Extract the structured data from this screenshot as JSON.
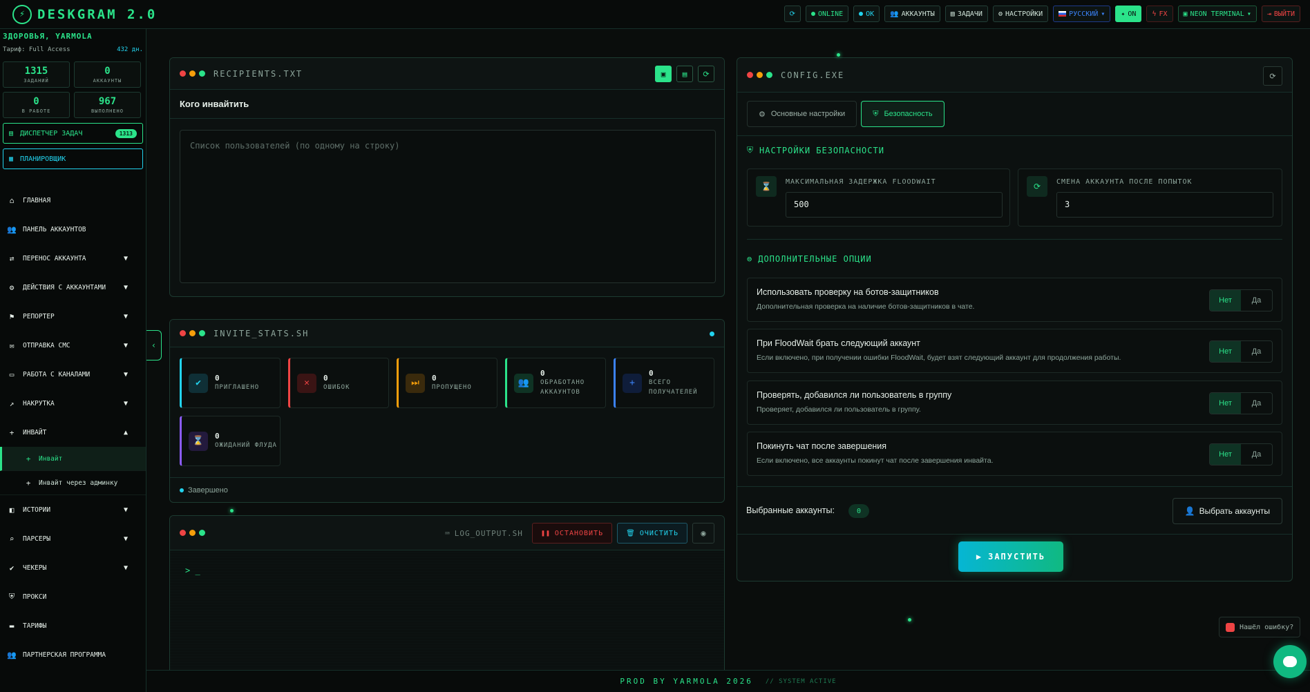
{
  "app": {
    "logo_mark": "⚡",
    "title": "DESKGRAM 2.0"
  },
  "topbar": {
    "refresh_icon": "refresh-icon",
    "online": "ONLINE",
    "ok": "OK",
    "accounts": "АККАУНТЫ",
    "tasks": "ЗАДАЧИ",
    "settings": "НАСТРОЙКИ",
    "language": "РУССКИЙ",
    "on": "ON",
    "fx": "FX",
    "theme": "NEON TERMINAL",
    "logout": "ВЫЙТИ"
  },
  "sidebar": {
    "greeting": "ЗДОРОВЬЯ, YARMOLA",
    "tariff_label": "Тариф: Full Access",
    "tariff_days": "432 дн.",
    "stats": [
      {
        "value": "1315",
        "label": "ЗАДАНИЙ"
      },
      {
        "value": "0",
        "label": "АККАУНТЫ"
      },
      {
        "value": "0",
        "label": "В РАБОТЕ"
      },
      {
        "value": "967",
        "label": "ВЫПОЛНЕНО"
      }
    ],
    "dispatcher": {
      "label": "ДИСПЕТЧЕР ЗАДАЧ",
      "badge": "1313"
    },
    "planner": "ПЛАНИРОВЩИК",
    "nav": [
      {
        "label": "ГЛАВНАЯ",
        "icon": "home-icon",
        "chev": ""
      },
      {
        "label": "ПАНЕЛЬ АККАУНТОВ",
        "icon": "users-icon",
        "chev": ""
      },
      {
        "label": "ПЕРЕНОС АККАУНТА",
        "icon": "user-transfer-icon",
        "chev": "▼"
      },
      {
        "label": "ДЕЙСТВИЯ С АККАУНТАМИ",
        "icon": "user-gear-icon",
        "chev": "▼"
      },
      {
        "label": "РЕПОРТЕР",
        "icon": "flag-icon",
        "chev": "▼"
      },
      {
        "label": "ОТПРАВКА СМС",
        "icon": "chat-icon",
        "chev": "▼"
      },
      {
        "label": "РАБОТА С КАНАЛАМИ",
        "icon": "briefcase-icon",
        "chev": "▼"
      },
      {
        "label": "НАКРУТКА",
        "icon": "chart-icon",
        "chev": "▼"
      },
      {
        "label": "ИНВАЙТ",
        "icon": "user-plus-icon",
        "chev": "▲"
      }
    ],
    "sub": [
      {
        "label": "Инвайт"
      },
      {
        "label": "Инвайт через админку"
      }
    ],
    "nav2": [
      {
        "label": "ИСТОРИИ",
        "icon": "stories-icon",
        "chev": "▼"
      },
      {
        "label": "ПАРСЕРЫ",
        "icon": "search-icon",
        "chev": "▼"
      },
      {
        "label": "ЧЕКЕРЫ",
        "icon": "check-icon",
        "chev": "▼"
      },
      {
        "label": "ПРОКСИ",
        "icon": "shield-icon",
        "chev": ""
      },
      {
        "label": "ТАРИФЫ",
        "icon": "card-icon",
        "chev": ""
      },
      {
        "label": "ПАРТНЕРСКАЯ ПРОГРАММА",
        "icon": "partners-icon",
        "chev": ""
      }
    ]
  },
  "recipients": {
    "title": "RECIPIENTS.TXT",
    "section": "Кого инвайтить",
    "placeholder": "Список пользователей (по одному на строку)"
  },
  "stats": {
    "title": "INVITE_STATS.SH",
    "tiles": [
      {
        "value": "0",
        "label": "ПРИГЛАШЕНО",
        "icon": "check-circle-icon",
        "color": "#22d3ee"
      },
      {
        "value": "0",
        "label": "ОШИБОК",
        "icon": "x-circle-icon",
        "color": "#ef4444"
      },
      {
        "value": "0",
        "label": "ПРОПУЩЕНО",
        "icon": "skip-icon",
        "color": "#f59e0b"
      },
      {
        "value": "0",
        "label": "ОБРАБОТАНО АККАУНТОВ",
        "icon": "users-icon",
        "color": "#2be38a"
      },
      {
        "value": "0",
        "label": "ВСЕГО ПОЛУЧАТЕЛЕЙ",
        "icon": "user-plus-icon",
        "color": "#3b82f6"
      },
      {
        "value": "0",
        "label": "ОЖИДАНИЙ ФЛУДА",
        "icon": "hourglass-icon",
        "color": "#8b5cf6"
      }
    ],
    "status": "Завершено"
  },
  "log": {
    "filename": "LOG_OUTPUT.SH",
    "stop": "ОСТАНОВИТЬ",
    "clear": "ОЧИСТИТЬ",
    "prompt": "> _"
  },
  "config": {
    "title": "CONFIG.EXE",
    "tab_main": "Основные настройки",
    "tab_security": "Безопасность",
    "security_heading": "НАСТРОЙКИ БЕЗОПАСНОСТИ",
    "floodwait_label": "МАКСИМАЛЬНАЯ ЗАДЕРЖКА FLOODWAIT",
    "floodwait_value": "500",
    "switch_label": "СМЕНА АККАУНТА ПОСЛЕ ПОПЫТОК",
    "switch_value": "3",
    "extra_heading": "ДОПОЛНИТЕЛЬНЫЕ ОПЦИИ",
    "options": [
      {
        "title": "Использовать проверку на ботов-защитников",
        "desc": "Дополнительная проверка на наличие ботов-защитников в чате.",
        "no": "Нет",
        "yes": "Да"
      },
      {
        "title": "При FloodWait брать следующий аккаунт",
        "desc": "Если включено, при получении ошибки FloodWait, будет взят следующий аккаунт для продолжения работы.",
        "no": "Нет",
        "yes": "Да"
      },
      {
        "title": "Проверять, добавился ли пользователь в группу",
        "desc": "Проверяет, добавился ли пользователь в группу.",
        "no": "Нет",
        "yes": "Да"
      },
      {
        "title": "Покинуть чат после завершения",
        "desc": "Если включено, все аккаунты покинут чат после завершения инвайта.",
        "no": "Нет",
        "yes": "Да"
      }
    ],
    "selected_label": "Выбранные аккаунты:",
    "selected_count": "0",
    "choose_btn": "Выбрать аккаунты",
    "run_btn": "ЗАПУСТИТЬ"
  },
  "footer": {
    "prod": "PROD BY YARMOLA 2026",
    "system": "// SYSTEM ACTIVE"
  },
  "bug_report": "Нашёл ошибку?",
  "colors": {
    "accent": "#2be38a",
    "cyan": "#22d3ee",
    "danger": "#ef4444",
    "bg": "#0a0d0c"
  }
}
